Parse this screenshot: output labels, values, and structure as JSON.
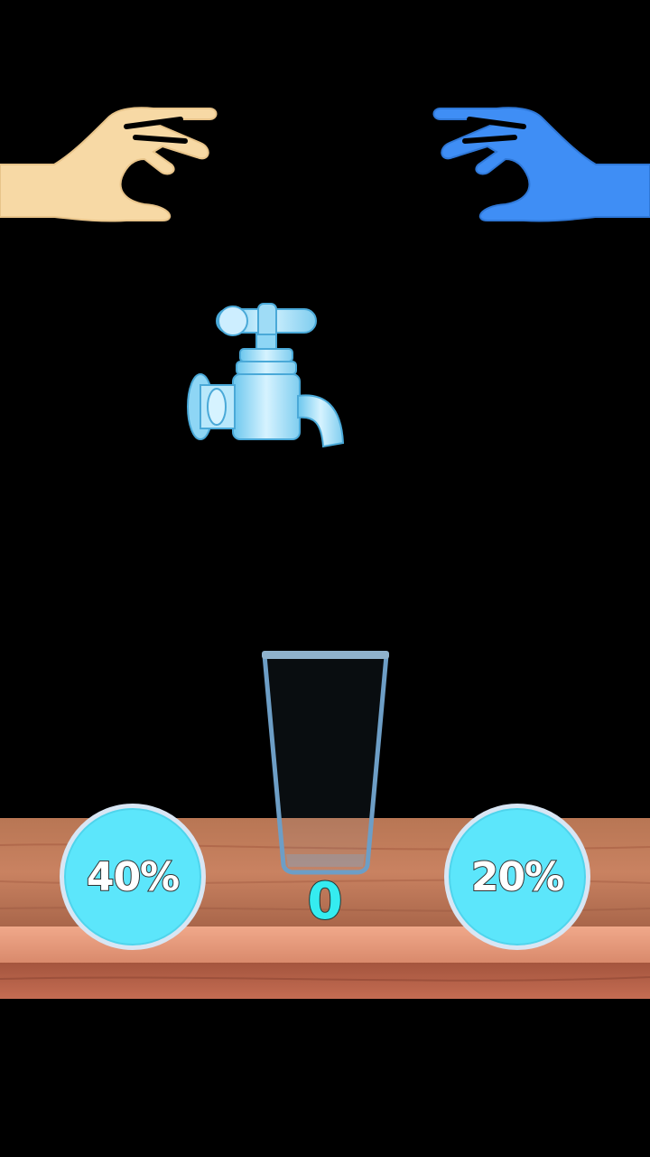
{
  "game": {
    "score": "0",
    "glass_fill_level": 0.0,
    "left_button": {
      "label": "40%",
      "owner": "left-hand"
    },
    "right_button": {
      "label": "20%",
      "owner": "right-hand"
    }
  },
  "colors": {
    "background": "#000000",
    "left_hand": "#f7d9a5",
    "right_hand": "#3f8ef5",
    "button_fill": "#5ce6fb",
    "score_text": "#35ecf0",
    "table_wood": "#c77a55",
    "faucet_blue": "#a9e2f7"
  },
  "icons": {
    "left_hand": "reaching-hand-icon",
    "right_hand": "reaching-hand-icon",
    "faucet": "water-faucet-icon",
    "glass": "empty-glass-icon"
  }
}
